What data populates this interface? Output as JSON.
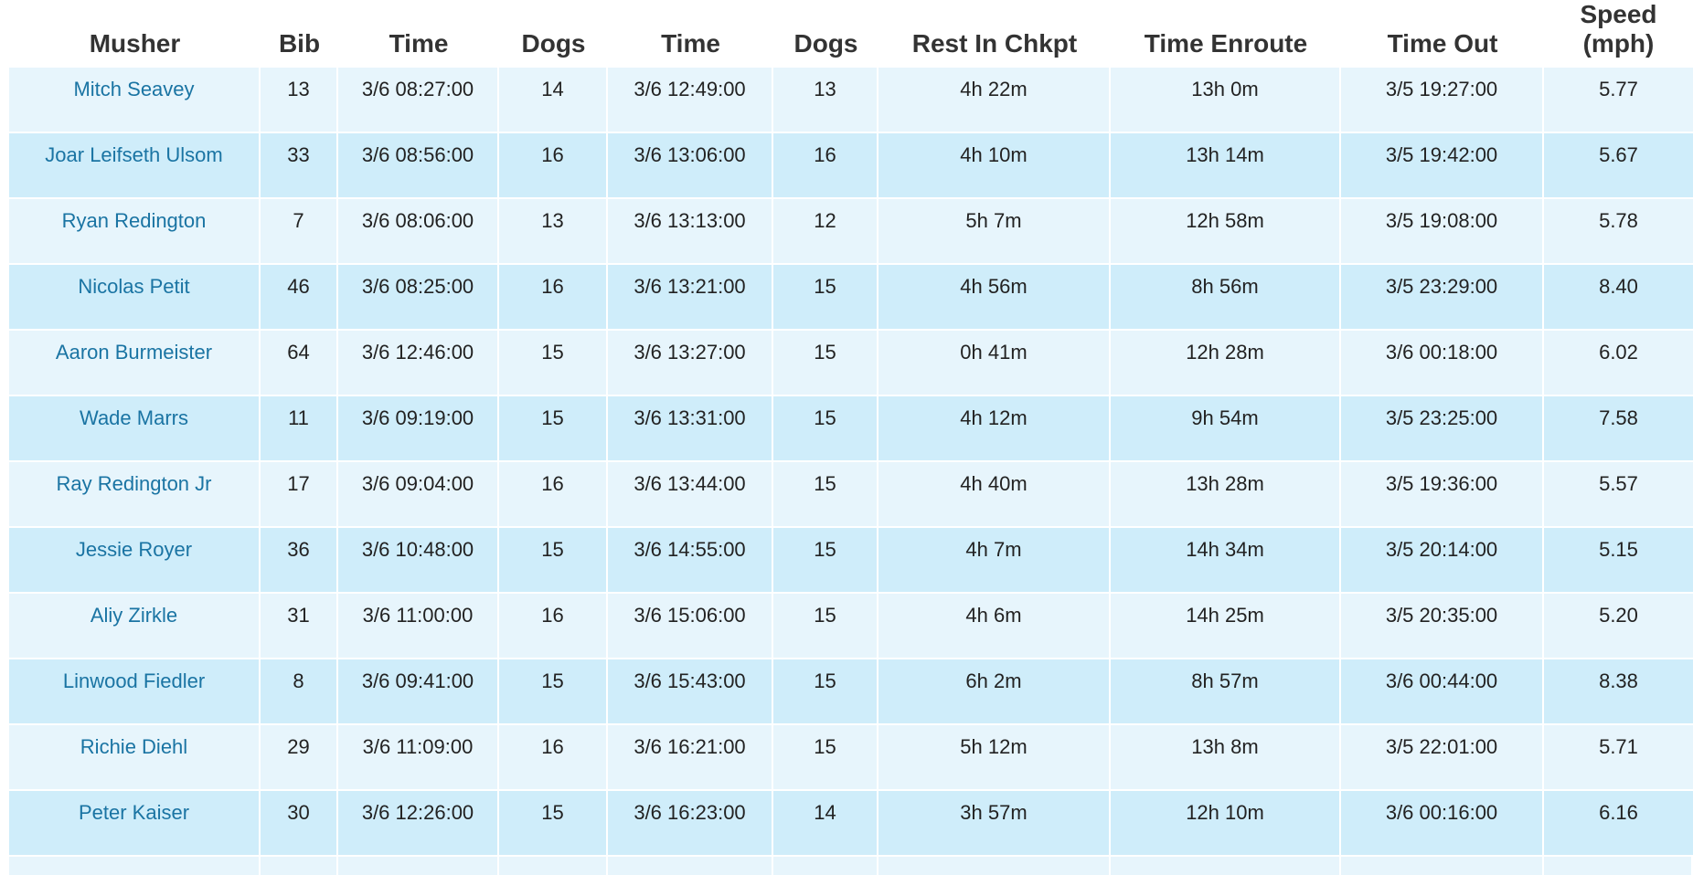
{
  "headers": [
    "Musher",
    "Bib",
    "Time",
    "Dogs",
    "Time",
    "Dogs",
    "Rest In Chkpt",
    "Time Enroute",
    "Time Out",
    "Speed (mph)"
  ],
  "speed_header": {
    "line1": "Speed",
    "line2": "(mph)"
  },
  "rows": [
    {
      "musher": "Mitch Seavey",
      "bib": "13",
      "time_in": "3/6 08:27:00",
      "dogs_in": "14",
      "time_out_chk": "3/6 12:49:00",
      "dogs_out": "13",
      "rest": "4h 22m",
      "enroute": "13h 0m",
      "time_out": "3/5 19:27:00",
      "speed": "5.77"
    },
    {
      "musher": "Joar Leifseth Ulsom",
      "bib": "33",
      "time_in": "3/6 08:56:00",
      "dogs_in": "16",
      "time_out_chk": "3/6 13:06:00",
      "dogs_out": "16",
      "rest": "4h 10m",
      "enroute": "13h 14m",
      "time_out": "3/5 19:42:00",
      "speed": "5.67"
    },
    {
      "musher": "Ryan Redington",
      "bib": "7",
      "time_in": "3/6 08:06:00",
      "dogs_in": "13",
      "time_out_chk": "3/6 13:13:00",
      "dogs_out": "12",
      "rest": "5h 7m",
      "enroute": "12h 58m",
      "time_out": "3/5 19:08:00",
      "speed": "5.78"
    },
    {
      "musher": "Nicolas Petit",
      "bib": "46",
      "time_in": "3/6 08:25:00",
      "dogs_in": "16",
      "time_out_chk": "3/6 13:21:00",
      "dogs_out": "15",
      "rest": "4h 56m",
      "enroute": "8h 56m",
      "time_out": "3/5 23:29:00",
      "speed": "8.40"
    },
    {
      "musher": "Aaron Burmeister",
      "bib": "64",
      "time_in": "3/6 12:46:00",
      "dogs_in": "15",
      "time_out_chk": "3/6 13:27:00",
      "dogs_out": "15",
      "rest": "0h 41m",
      "enroute": "12h 28m",
      "time_out": "3/6 00:18:00",
      "speed": "6.02"
    },
    {
      "musher": "Wade Marrs",
      "bib": "11",
      "time_in": "3/6 09:19:00",
      "dogs_in": "15",
      "time_out_chk": "3/6 13:31:00",
      "dogs_out": "15",
      "rest": "4h 12m",
      "enroute": "9h 54m",
      "time_out": "3/5 23:25:00",
      "speed": "7.58"
    },
    {
      "musher": "Ray Redington Jr",
      "bib": "17",
      "time_in": "3/6 09:04:00",
      "dogs_in": "16",
      "time_out_chk": "3/6 13:44:00",
      "dogs_out": "15",
      "rest": "4h 40m",
      "enroute": "13h 28m",
      "time_out": "3/5 19:36:00",
      "speed": "5.57"
    },
    {
      "musher": "Jessie Royer",
      "bib": "36",
      "time_in": "3/6 10:48:00",
      "dogs_in": "15",
      "time_out_chk": "3/6 14:55:00",
      "dogs_out": "15",
      "rest": "4h 7m",
      "enroute": "14h 34m",
      "time_out": "3/5 20:14:00",
      "speed": "5.15"
    },
    {
      "musher": "Aliy Zirkle",
      "bib": "31",
      "time_in": "3/6 11:00:00",
      "dogs_in": "16",
      "time_out_chk": "3/6 15:06:00",
      "dogs_out": "15",
      "rest": "4h 6m",
      "enroute": "14h 25m",
      "time_out": "3/5 20:35:00",
      "speed": "5.20"
    },
    {
      "musher": "Linwood Fiedler",
      "bib": "8",
      "time_in": "3/6 09:41:00",
      "dogs_in": "15",
      "time_out_chk": "3/6 15:43:00",
      "dogs_out": "15",
      "rest": "6h 2m",
      "enroute": "8h 57m",
      "time_out": "3/6 00:44:00",
      "speed": "8.38"
    },
    {
      "musher": "Richie Diehl",
      "bib": "29",
      "time_in": "3/6 11:09:00",
      "dogs_in": "16",
      "time_out_chk": "3/6 16:21:00",
      "dogs_out": "15",
      "rest": "5h 12m",
      "enroute": "13h 8m",
      "time_out": "3/5 22:01:00",
      "speed": "5.71"
    },
    {
      "musher": "Peter Kaiser",
      "bib": "30",
      "time_in": "3/6 12:26:00",
      "dogs_in": "15",
      "time_out_chk": "3/6 16:23:00",
      "dogs_out": "14",
      "rest": "3h 57m",
      "enroute": "12h 10m",
      "time_out": "3/6 00:16:00",
      "speed": "6.16"
    }
  ],
  "colors": {
    "row_odd": "#e7f5fc",
    "row_even": "#cfedfa",
    "link": "#1a74a3",
    "header": "#333333"
  }
}
